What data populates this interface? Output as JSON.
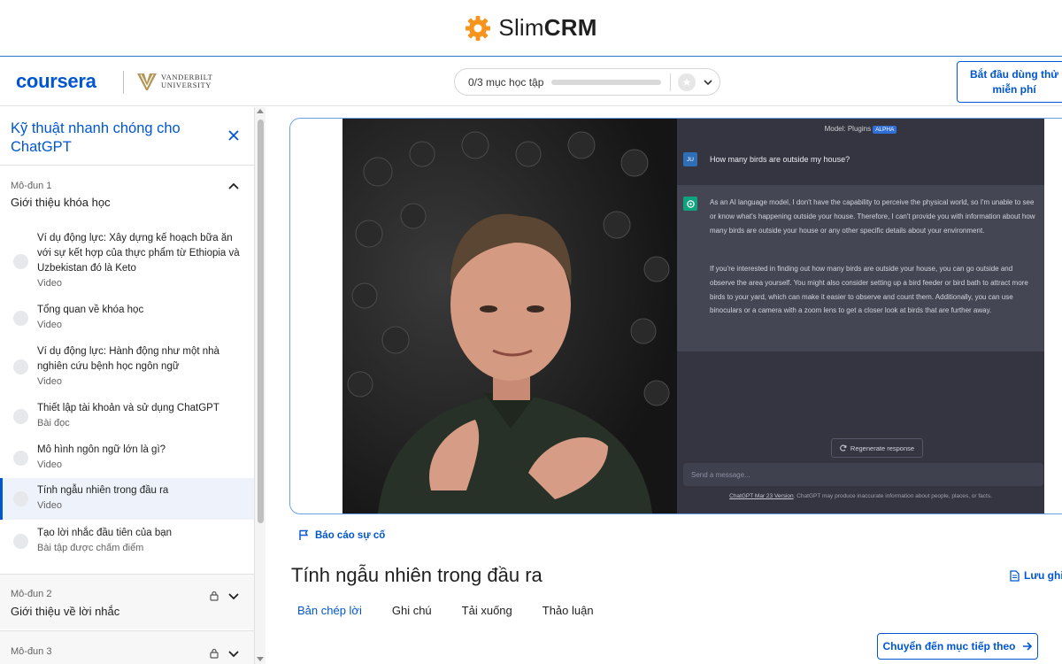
{
  "banner": {
    "brand_regular": "Slim",
    "brand_bold": "CRM"
  },
  "header": {
    "coursera": "coursera",
    "partner_line1": "VANDERBILT",
    "partner_line2": "UNIVERSITY",
    "progress_text": "0/3 mục học tập",
    "progress_fraction": 0.0,
    "start_button": "Bắt đầu dùng thử miễn phí"
  },
  "sidebar": {
    "course_title": "Kỹ thuật nhanh chóng cho ChatGPT",
    "module1": {
      "label": "Mô-đun 1",
      "title": "Giới thiệu khóa học",
      "items": [
        {
          "title": "Ví dụ động lực: Xây dựng kế hoạch bữa ăn với sự kết hợp của thực phẩm từ Ethiopia và Uzbekistan đó là Keto",
          "type": "Video"
        },
        {
          "title": "Tổng quan về khóa học",
          "type": "Video"
        },
        {
          "title": "Ví dụ động lực: Hành động như một nhà nghiên cứu bệnh học ngôn ngữ",
          "type": "Video"
        },
        {
          "title": "Thiết lập tài khoản và sử dụng ChatGPT",
          "type": "Bài đọc"
        },
        {
          "title": "Mô hình ngôn ngữ lớn là gì?",
          "type": "Video"
        },
        {
          "title": "Tính ngẫu nhiên trong đầu ra",
          "type": "Video"
        },
        {
          "title": "Tạo lời nhắc đầu tiên của bạn",
          "type": "Bài tập được chấm điểm"
        }
      ]
    },
    "module2": {
      "label": "Mô-đun 2",
      "title": "Giới thiệu về lời nhắc"
    },
    "module3": {
      "label": "Mô-đun 3"
    }
  },
  "video": {
    "chat": {
      "model_label": "Model: Plugins",
      "model_badge": "ALPHA",
      "user_initials": "JU",
      "question": "How many birds are outside my house?",
      "answer_p1": "As an AI language model, I don't have the capability to perceive the physical world, so I'm unable to see or know what's happening outside your house. Therefore, I can't provide you with information about how many birds are outside your house or any other specific details about your environment.",
      "answer_p2": "If you're interested in finding out how many birds are outside your house, you can go outside and observe the area yourself. You might also consider setting up a bird feeder or bird bath to attract more birds to your yard, which can make it easier to observe and count them. Additionally, you can use binoculars or a camera with a zoom lens to get a closer look at birds that are further away.",
      "regenerate": "Regenerate response",
      "message_placeholder": "Send a message...",
      "footer_link": "ChatGPT Mar 23 Version",
      "footer_text": ". ChatGPT may produce inaccurate information about people, places, or facts."
    }
  },
  "main": {
    "report": "Báo cáo sự cố",
    "lesson_title": "Tính ngẫu nhiên trong đầu ra",
    "save_note": "Lưu ghi",
    "tabs": [
      "Bản chép lời",
      "Ghi chú",
      "Tải xuống",
      "Thảo luận"
    ],
    "next_button": "Chuyển đến mục tiếp theo"
  },
  "colors": {
    "accent": "#0056d2",
    "brand_orange": "#f7941d",
    "chat_bg": "#343541"
  }
}
